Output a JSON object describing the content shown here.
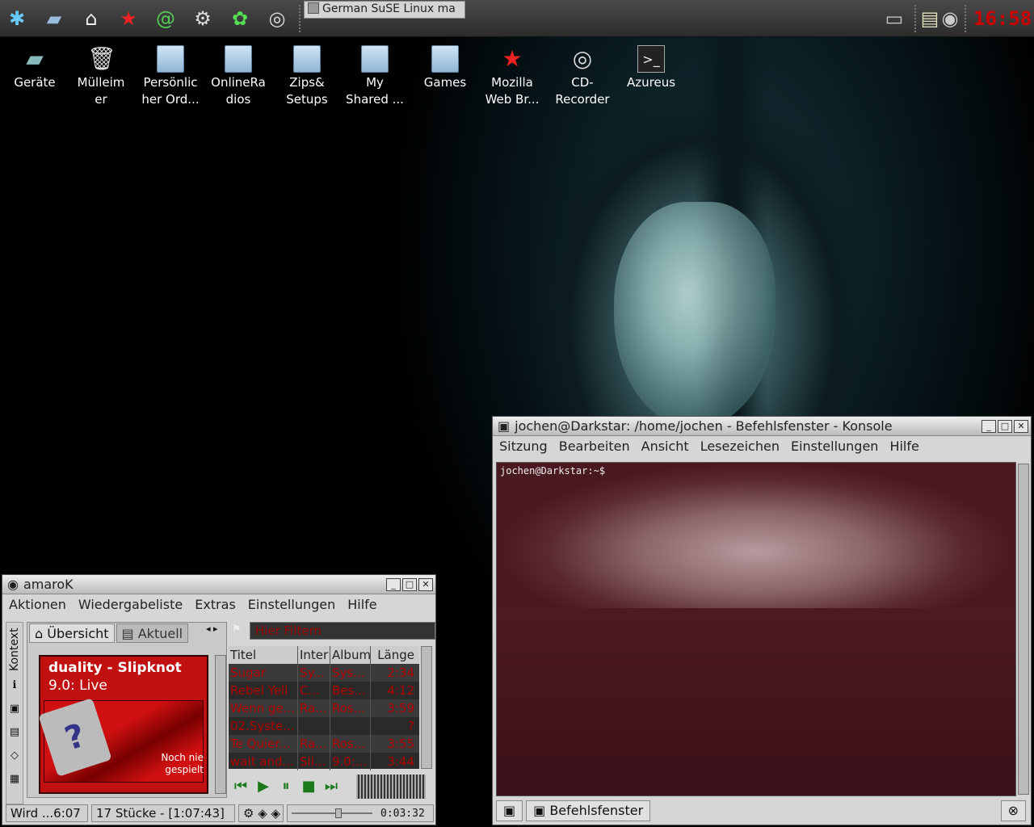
{
  "panel": {
    "task_button": "German SuSE Linux ma",
    "clock": "16:58",
    "launchers": [
      "kde-menu-icon",
      "drive-icon",
      "home-icon",
      "star-browser-icon",
      "email-icon",
      "steam-icon",
      "flower-icon",
      "cd-icon"
    ]
  },
  "desktop": {
    "icons": [
      {
        "label": "Geräte",
        "icon": "drive-icon"
      },
      {
        "label": "Mülleim\ner",
        "icon": "trash-icon"
      },
      {
        "label": "Persönlic\nher Ord...",
        "icon": "home-folder-icon"
      },
      {
        "label": "OnlineRa\ndios",
        "icon": "folder-icon"
      },
      {
        "label": "Zips&\nSetups",
        "icon": "folder-icon"
      },
      {
        "label": "My\nShared ...",
        "icon": "folder-icon"
      },
      {
        "label": "Games",
        "icon": "folder-icon"
      },
      {
        "label": "Mozilla\nWeb Br...",
        "icon": "mozilla-icon"
      },
      {
        "label": "CD-\nRecorder",
        "icon": "cd-recorder-icon"
      },
      {
        "label": "Azureus",
        "icon": "terminal-icon"
      }
    ]
  },
  "amarok": {
    "title": "amaroK",
    "menu": [
      "Aktionen",
      "Wiedergabeliste",
      "Extras",
      "Einstellungen",
      "Hilfe"
    ],
    "side_tab": "Kontext",
    "tabs": [
      "Übersicht",
      "Aktuell"
    ],
    "filter_placeholder": "Hier Filtern",
    "now_playing": {
      "title": "duality - Slipknot",
      "album": "9.0: Live",
      "never_played": "Noch nie\ngespielt"
    },
    "playlist_headers": [
      "Titel",
      "Inter",
      "Album",
      "Länge"
    ],
    "playlist": [
      [
        "Sugar",
        "Sy...",
        "Sys...",
        "2:34"
      ],
      [
        "Rebel Yell",
        "C...",
        "Bes...",
        "4:12"
      ],
      [
        "Wenn ge...",
        "Ra...",
        "Ros...",
        "3:59"
      ],
      [
        "02.Syste...",
        "",
        "",
        "?"
      ],
      [
        "Te Quier...",
        "Ra...",
        "Ros...",
        "3:55"
      ],
      [
        "wait and...",
        "Sli...",
        "9.0:...",
        "3:44"
      ]
    ],
    "status": {
      "left": "Wird ...6:07",
      "tracks": "17 Stücke - [1:07:43]",
      "time": "0:03:32"
    }
  },
  "konsole": {
    "title": "jochen@Darkstar: /home/jochen - Befehlsfenster - Konsole",
    "menu": [
      "Sitzung",
      "Bearbeiten",
      "Ansicht",
      "Lesezeichen",
      "Einstellungen",
      "Hilfe"
    ],
    "prompt": "jochen@Darkstar:~$",
    "session_tab": "Befehlsfenster"
  }
}
